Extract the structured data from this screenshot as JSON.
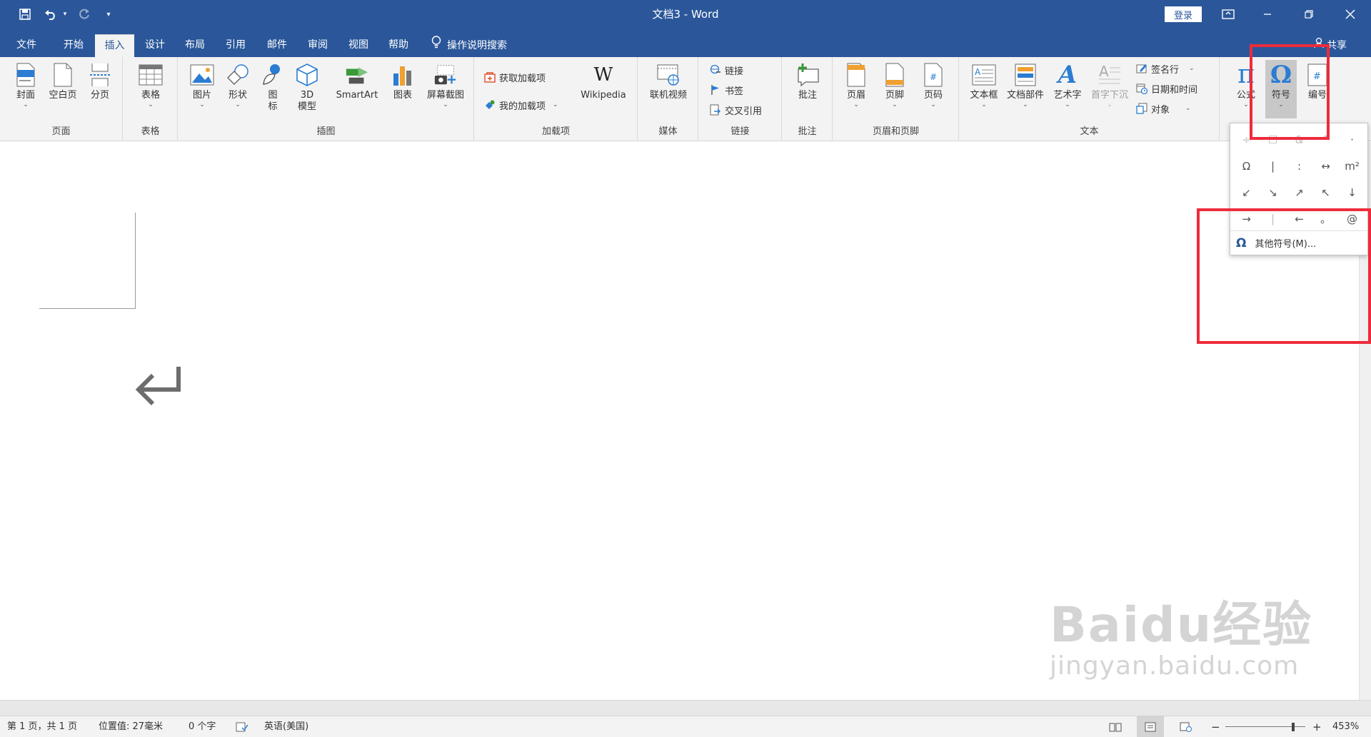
{
  "title_bar": {
    "window_title": "文档3 - Word",
    "login_label": "登录",
    "icons": [
      "save-icon",
      "undo-icon",
      "redo-icon",
      "customize-qat-icon",
      "ribbon-display-icon",
      "minimize-icon",
      "restore-icon",
      "close-icon"
    ]
  },
  "tabs": [
    {
      "label": "文件"
    },
    {
      "label": "开始"
    },
    {
      "label": "插入"
    },
    {
      "label": "设计"
    },
    {
      "label": "布局"
    },
    {
      "label": "引用"
    },
    {
      "label": "邮件"
    },
    {
      "label": "审阅"
    },
    {
      "label": "视图"
    },
    {
      "label": "帮助"
    }
  ],
  "active_tab": "插入",
  "tell_me": "操作说明搜索",
  "share": "共享",
  "ribbon": {
    "groups": {
      "pages": "页面",
      "tables": "表格",
      "illustrations": "插图",
      "addins": "加载项",
      "media": "媒体",
      "links": "链接",
      "comments": "批注",
      "header_footer": "页眉和页脚",
      "text": "文本"
    },
    "buttons": {
      "cover": "封面",
      "blank": "空白页",
      "break": "分页",
      "table": "表格",
      "picture": "图片",
      "shapes": "形状",
      "icons_l1": "图",
      "icons_l2": "标",
      "model_l1": "3D",
      "model_l2": "模型",
      "smartart": "SmartArt",
      "chart": "图表",
      "screenshot": "屏幕截图",
      "get_addins": "获取加载项",
      "my_addins": "我的加载项",
      "wikipedia": "Wikipedia",
      "online_video": "联机视频",
      "link": "链接",
      "bookmark": "书签",
      "cross_ref": "交叉引用",
      "comment": "批注",
      "header": "页眉",
      "footer": "页脚",
      "page_number": "页码",
      "textbox": "文本框",
      "quick_parts": "文档部件",
      "wordart": "艺术字",
      "dropcap": "首字下沉",
      "signature": "签名行",
      "datetime": "日期和时间",
      "object": "对象",
      "equation": "公式",
      "symbol": "符号",
      "numbering": "编号"
    }
  },
  "symbol_dropdown": {
    "rows": [
      [
        "÷",
        "☐",
        "&",
        "^",
        "·"
      ],
      [
        "Ω",
        "|",
        ":",
        "↔",
        "m²"
      ],
      [
        "↙",
        "↘",
        "↗",
        "↖",
        "↓"
      ],
      [
        "→",
        "|",
        "←",
        "。",
        "@"
      ]
    ],
    "more_label": "其他符号(M)..."
  },
  "watermark": {
    "text": "Baidu经验",
    "url": "jingyan.baidu.com"
  },
  "status_bar": {
    "page": "第 1 页，共 1 页",
    "position": "位置值: 27毫米",
    "words": "0 个字",
    "language": "英语(美国)",
    "zoom": "453%",
    "zoom_level": 0.85
  },
  "colors": {
    "title_blue": "#2b579a",
    "highlight_red": "#ee2b3a"
  }
}
